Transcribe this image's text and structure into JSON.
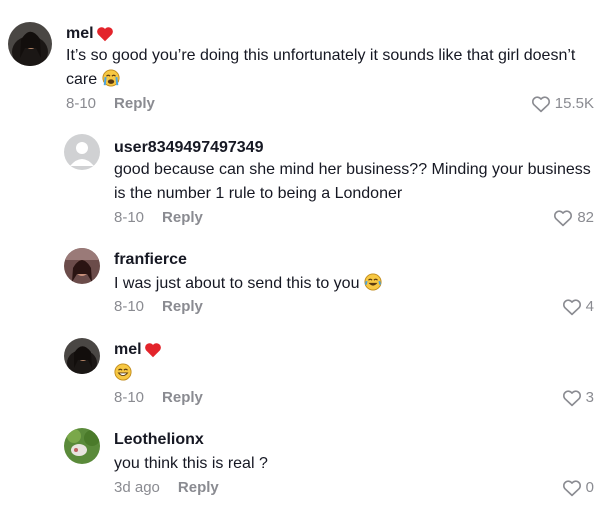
{
  "comments": [
    {
      "username": "mel",
      "text_line1": "It’s so good you’re doing this unfortunately it sounds like that girl doesn’t",
      "text_line2": "care",
      "date": "8-10",
      "reply_label": "Reply",
      "likes": "15.5K"
    },
    {
      "username": "user8349497497349",
      "text_line1": "good because can she mind her business?? Minding your business",
      "text_line2": "is the number 1 rule to being a Londoner",
      "date": "8-10",
      "reply_label": "Reply",
      "likes": "82"
    },
    {
      "username": "franfierce",
      "text_line1": "I was just about to send this to you",
      "date": "8-10",
      "reply_label": "Reply",
      "likes": "4"
    },
    {
      "username": "mel",
      "date": "8-10",
      "reply_label": "Reply",
      "likes": "3"
    },
    {
      "username": "Leothelionx",
      "text_line1": "you think this is real ?",
      "date": "3d ago",
      "reply_label": "Reply",
      "likes": "0"
    }
  ],
  "colors": {
    "text": "#161823",
    "secondary": "#8a8b91",
    "heart": "#fe2c55"
  }
}
